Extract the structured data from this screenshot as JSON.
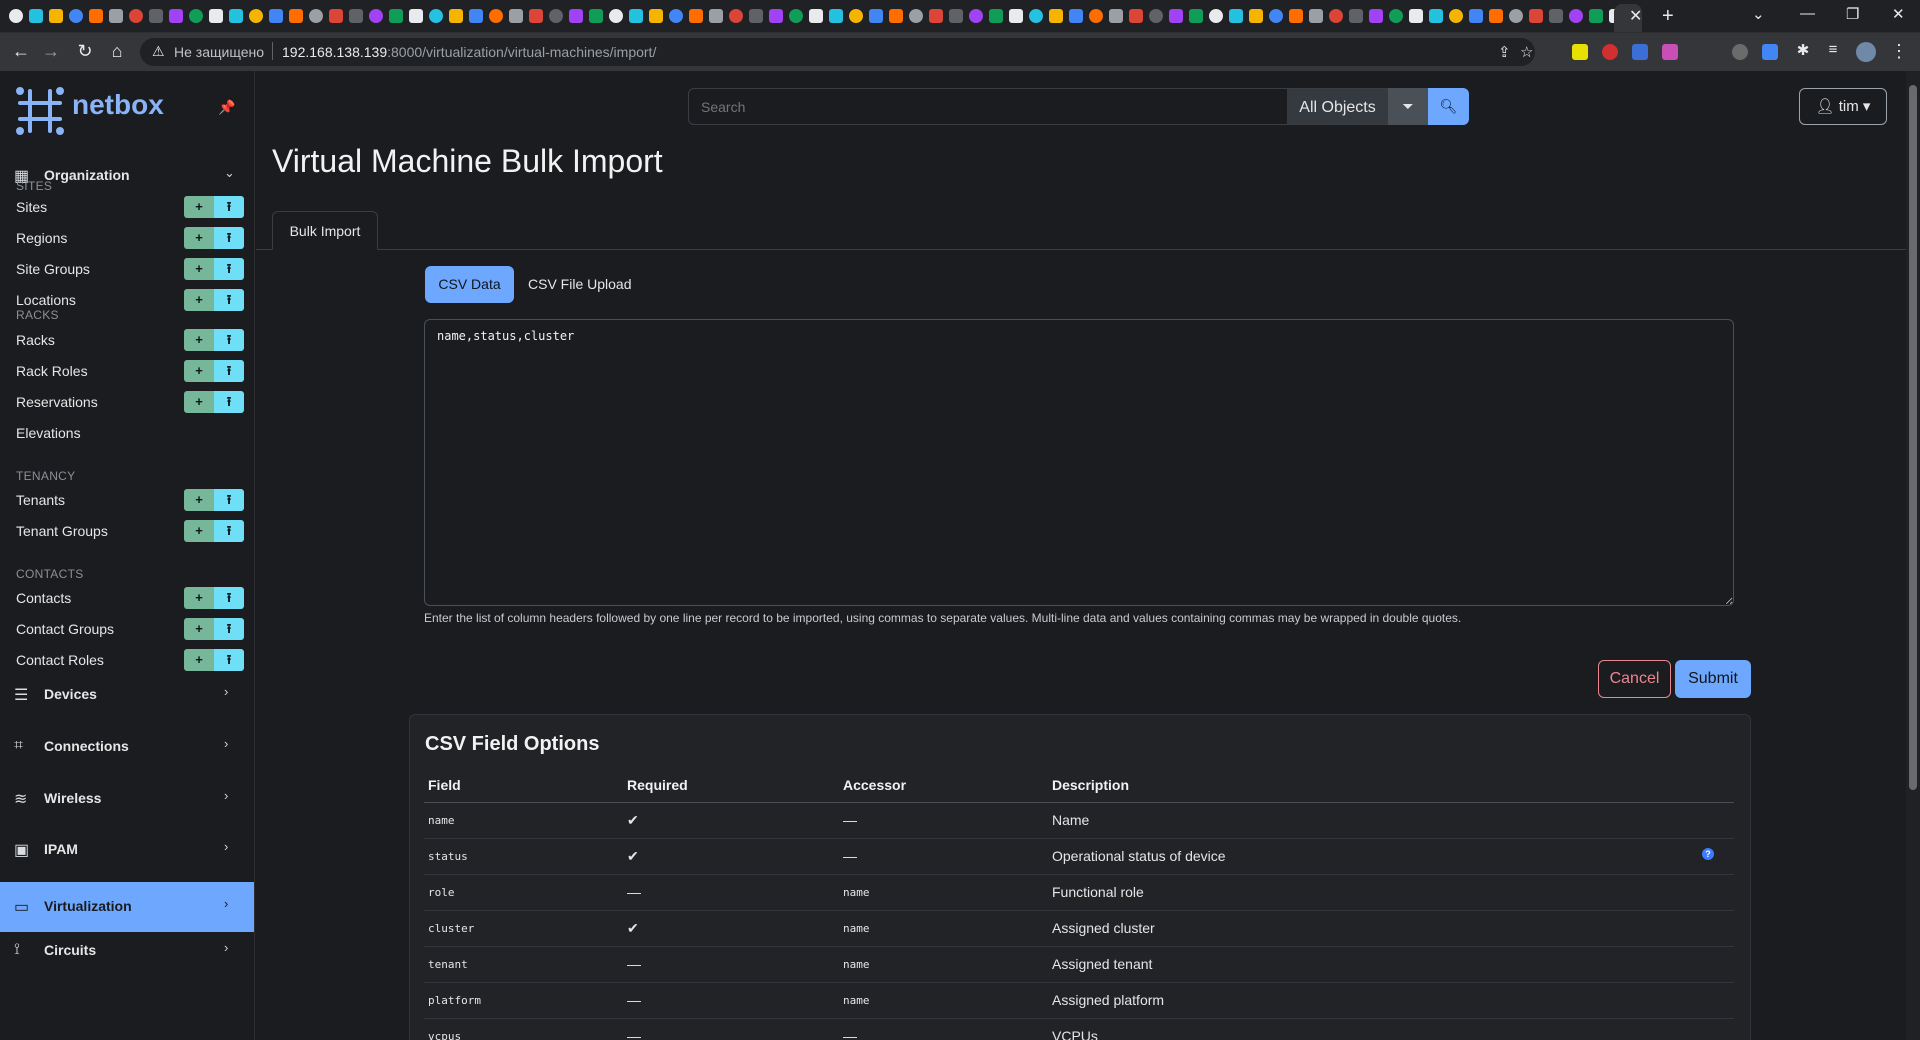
{
  "browser": {
    "address_security": "Не защищено",
    "url_host": "192.168.138.139",
    "url_path": ":8000/virtualization/virtual-machines/import/"
  },
  "colors": {
    "accent": "#6ea8fe",
    "success": "#75b798",
    "info": "#6edff6",
    "danger": "#ea868f",
    "background": "#1b1c1f"
  },
  "sidebar": {
    "brand": "netbox",
    "sections": [
      {
        "label": "Organization",
        "icon": "building-icon"
      },
      {
        "label": "Devices",
        "icon": "server-icon"
      },
      {
        "label": "Connections",
        "icon": "cable-icon"
      },
      {
        "label": "Wireless",
        "icon": "wifi-icon"
      },
      {
        "label": "IPAM",
        "icon": "ip-icon"
      },
      {
        "label": "Virtualization",
        "icon": "monitor-icon"
      },
      {
        "label": "Circuits",
        "icon": "circuit-icon"
      }
    ],
    "groups": [
      "SITES",
      "RACKS",
      "TENANCY",
      "CONTACTS"
    ],
    "items": [
      {
        "label": "Sites"
      },
      {
        "label": "Regions"
      },
      {
        "label": "Site Groups"
      },
      {
        "label": "Locations"
      },
      {
        "label": "Racks"
      },
      {
        "label": "Rack Roles"
      },
      {
        "label": "Reservations"
      },
      {
        "label": "Elevations"
      },
      {
        "label": "Tenants"
      },
      {
        "label": "Tenant Groups"
      },
      {
        "label": "Contacts"
      },
      {
        "label": "Contact Groups"
      },
      {
        "label": "Contact Roles"
      }
    ],
    "add_glyph": "+",
    "import_glyph": "⭱"
  },
  "header": {
    "search_placeholder": "Search",
    "search_scope": "All Objects",
    "user": "tim"
  },
  "page": {
    "title": "Virtual Machine Bulk Import",
    "tab": "Bulk Import",
    "pill_csv": "CSV Data",
    "pill_file": "CSV File Upload",
    "csv_value": "name,status,cluster",
    "help": "Enter the list of column headers followed by one line per record to be imported, using commas to separate values. Multi-line data and values containing commas may be wrapped in double quotes.",
    "cancel": "Cancel",
    "submit": "Submit"
  },
  "field_options": {
    "title": "CSV Field Options",
    "columns": [
      "Field",
      "Required",
      "Accessor",
      "Description"
    ],
    "rows": [
      {
        "field": "name",
        "required": "✔",
        "accessor": "—",
        "description": "Name"
      },
      {
        "field": "status",
        "required": "✔",
        "accessor": "—",
        "description": "Operational status of device"
      },
      {
        "field": "role",
        "required": "—",
        "accessor": "name",
        "description": "Functional role"
      },
      {
        "field": "cluster",
        "required": "✔",
        "accessor": "name",
        "description": "Assigned cluster"
      },
      {
        "field": "tenant",
        "required": "—",
        "accessor": "name",
        "description": "Assigned tenant"
      },
      {
        "field": "platform",
        "required": "—",
        "accessor": "name",
        "description": "Assigned platform"
      },
      {
        "field": "vcpus",
        "required": "—",
        "accessor": "—",
        "description": "VCPUs"
      }
    ]
  }
}
